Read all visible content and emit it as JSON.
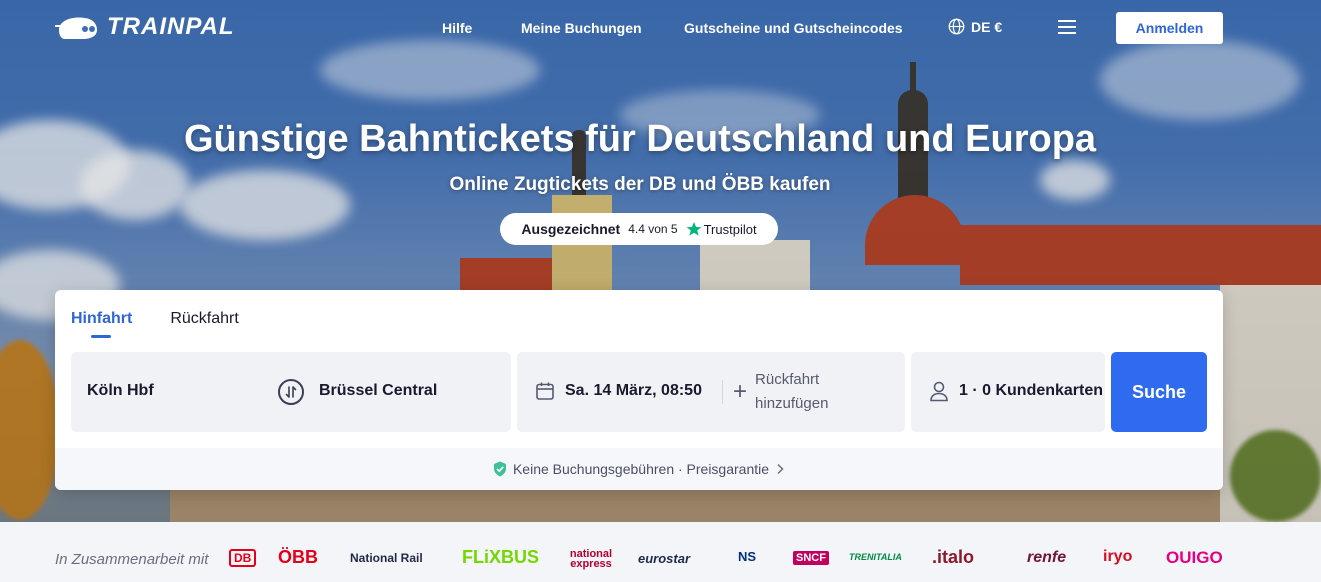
{
  "brand": {
    "name": "TRAINPAL"
  },
  "nav": {
    "help": "Hilfe",
    "bookings": "Meine Buchungen",
    "vouchers": "Gutscheine und Gutscheincodes",
    "language": "DE €",
    "login": "Anmelden"
  },
  "hero": {
    "title": "Günstige Bahntickets für Deutschland und Europa",
    "subtitle": "Online Zugtickets der DB und ÖBB kaufen",
    "trust_word": "Ausgezeichnet",
    "trust_score": "4.4 von 5",
    "trust_brand": "Trustpilot"
  },
  "search": {
    "tabs": [
      "Hinfahrt",
      "Rückfahrt"
    ],
    "active_tab": 0,
    "from": "Köln Hbf",
    "to": "Brüssel Central",
    "date": "Sa. 14 März, 08:50",
    "add_return": "Rückfahrt hinzufügen",
    "passengers": "1 · 0 Kundenkarten",
    "submit": "Suche",
    "guarantee": "Keine Buchungsgebühren · Preisgarantie"
  },
  "partners": {
    "label": "In Zusammenarbeit mit",
    "logos": [
      "DB",
      "ÖBB",
      "National Rail",
      "FLiXBUS",
      "national express",
      "eurostar",
      "NS",
      "SNCF",
      "TRENITALIA",
      ".italo",
      "renfe",
      "iryo",
      "OUIGO"
    ]
  },
  "colors": {
    "accent": "#2f66d4",
    "search_button": "#2f6bef",
    "trustpilot_star": "#00b67a"
  },
  "icons": [
    "logo-train-icon",
    "globe-icon",
    "menu-icon",
    "star-icon",
    "swap-icon",
    "calendar-icon",
    "plus-icon",
    "person-icon",
    "shield-check-icon",
    "chevron-right-icon"
  ]
}
